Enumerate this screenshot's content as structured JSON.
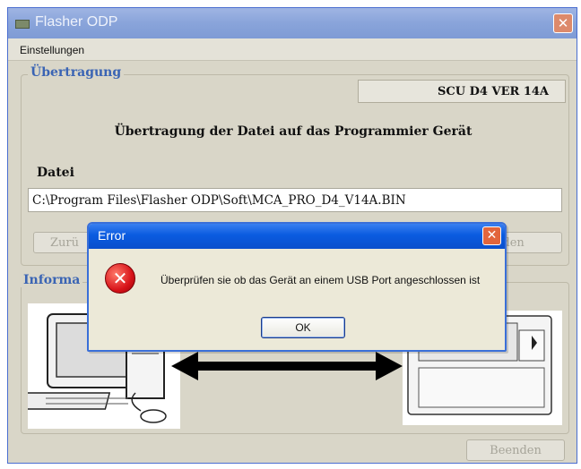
{
  "window": {
    "title": "Flasher ODP",
    "close_glyph": "✕"
  },
  "menu": {
    "items": [
      {
        "label": "Einstellungen"
      }
    ]
  },
  "transfer_group": {
    "label": "Übertragung",
    "version": "SCU D4 VER  14A",
    "heading": "Übertragung der Datei auf das Programmier Gerät",
    "file_label": "Datei",
    "file_path": "C:\\Program Files\\Flasher ODP\\Soft\\MCA_PRO_D4_V14A.BIN",
    "back_button_visible": "Zurü",
    "send_button_visible": "nden"
  },
  "info_group": {
    "label_visible": "Informa"
  },
  "footer": {
    "exit_button": "Beenden"
  },
  "error_dialog": {
    "title": "Error",
    "close_glyph": "✕",
    "icon": "error-icon",
    "message": "Überprüfen sie ob das Gerät an einem USB Port angeschlossen ist",
    "ok_label": "OK"
  },
  "colors": {
    "accent": "#0a5be0",
    "label_blue": "#3a64b4",
    "window_bg": "#d9d6c8"
  }
}
